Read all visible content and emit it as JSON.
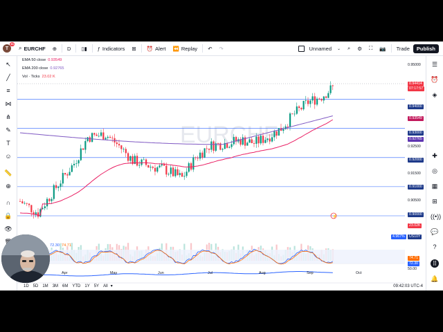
{
  "toolbar": {
    "logo_letter": "T",
    "logo_badge": "11",
    "symbol": "EURCHF",
    "interval": "D",
    "indicators": "Indicators",
    "alert": "Alert",
    "replay": "Replay",
    "layout_name": "Unnamed",
    "trade": "Trade",
    "publish": "Publish"
  },
  "legend": {
    "ema50_label": "EMA 50 close",
    "ema50_value": "0.93549",
    "ema200_label": "EMA 200 close",
    "ema200_value": "0.92765",
    "vol_label": "Vol · Ticks",
    "vol_value": "23.02 K",
    "stoch_label": "72.30",
    "stoch_value2": "74.71"
  },
  "price_axis": {
    "ticks": [
      "0.95000",
      "0.93000",
      "0.92500",
      "0.91500",
      "0.90500"
    ],
    "lines": [
      "0.94000",
      "0.93000",
      "0.92000",
      "0.91000",
      "0.90000"
    ],
    "ema50": "0.93549",
    "ema200": "0.92765",
    "last_price": "0.94414",
    "countdown": "07:17:57",
    "symbol_tag": "EURCHF",
    "volume": "23.02K",
    "us10y_label": "US10Y",
    "us10y_value": "4.967%",
    "stoch_a": "74.71",
    "stoch_b": "72.30",
    "stoch_c": "50.00"
  },
  "time_axis": [
    "Apr",
    "May",
    "Jun",
    "Jul",
    "Aug",
    "Sep",
    "Oct"
  ],
  "bottom": {
    "ranges": [
      "1D",
      "5D",
      "1M",
      "3M",
      "6M",
      "YTD",
      "1Y",
      "5Y",
      "All"
    ],
    "clock": "09:42:03 UTC-4"
  },
  "watermark": "EURCHF",
  "colors": {
    "up": "#089981",
    "down": "#f23645",
    "ema50": "#e91e63",
    "ema200": "#7e57c2",
    "hline": "#2962ff",
    "us10y": "#2962ff"
  },
  "chart_data": {
    "type": "candlestick",
    "symbol": "EURCHF",
    "interval": "D",
    "ylim": [
      0.9,
      0.952
    ],
    "x_labels": [
      "Apr",
      "May",
      "Jun",
      "Jul",
      "Aug",
      "Sep",
      "Oct"
    ],
    "horizontal_levels": [
      0.94,
      0.93,
      0.92,
      0.91,
      0.9
    ],
    "last_close": 0.94414,
    "ema50_last": 0.93549,
    "ema200_last": 0.92765,
    "volume_last": "23.02K",
    "stochastic": [
      74.71,
      72.3
    ],
    "stochastic_band": [
      20,
      80
    ]
  }
}
